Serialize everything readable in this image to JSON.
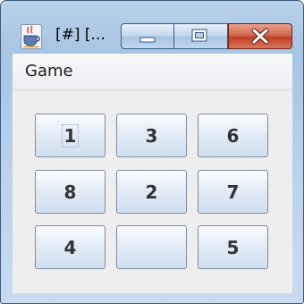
{
  "window": {
    "title": "[#]  [..."
  },
  "menubar": {
    "items": [
      {
        "label": "Game"
      }
    ]
  },
  "puzzle": {
    "tiles": [
      "1",
      "3",
      "6",
      "8",
      "2",
      "7",
      "4",
      "",
      "5"
    ],
    "focused_tile_index": 0
  },
  "colors": {
    "title_gradient_top": "#b9d1ea",
    "close_button": "#c13f23",
    "content_background": "#eeeeee",
    "tile_border": "#7a8ba3",
    "tile_text": "#333333"
  },
  "icons": {
    "app": "java-coffee-cup-icon",
    "minimize": "minimize-icon",
    "maximize": "maximize-icon",
    "close": "close-icon"
  }
}
